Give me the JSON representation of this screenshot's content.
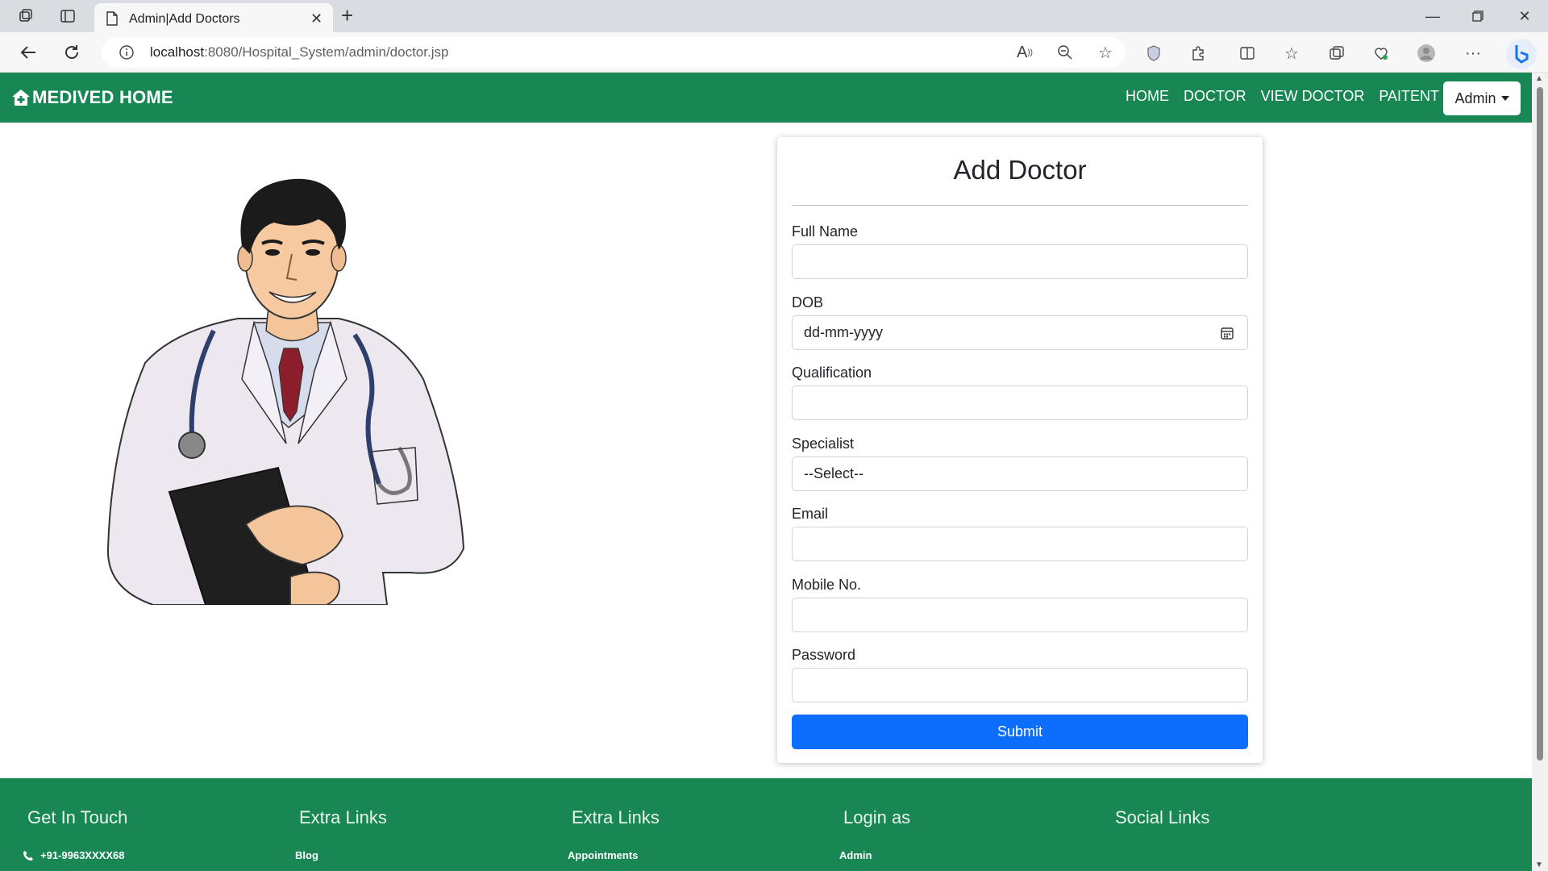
{
  "browser": {
    "tab_title": "Admin|Add Doctors",
    "url_host": "localhost",
    "url_path": ":8080/Hospital_System/admin/doctor.jsp"
  },
  "navbar": {
    "brand": "MEDIVED HOME",
    "links": [
      "HOME",
      "DOCTOR",
      "VIEW DOCTOR",
      "PAITENT"
    ],
    "admin_label": "Admin"
  },
  "form": {
    "title": "Add Doctor",
    "full_name_label": "Full Name",
    "dob_label": "DOB",
    "dob_placeholder": "dd-mm-yyyy",
    "qualification_label": "Qualification",
    "specialist_label": "Specialist",
    "specialist_selected": "--Select--",
    "email_label": "Email",
    "mobile_label": "Mobile No.",
    "password_label": "Password",
    "submit_label": "Submit"
  },
  "footer": {
    "columns": [
      {
        "title": "Get In Touch",
        "item": "+91-9963XXXX68"
      },
      {
        "title": "Extra Links",
        "item": "Blog"
      },
      {
        "title": "Extra Links",
        "item": "Appointments"
      },
      {
        "title": "Login as",
        "item": "Admin"
      },
      {
        "title": "Social Links",
        "item": ""
      }
    ]
  },
  "colors": {
    "navbar_green": "#198754",
    "submit_blue": "#0d6efd"
  }
}
